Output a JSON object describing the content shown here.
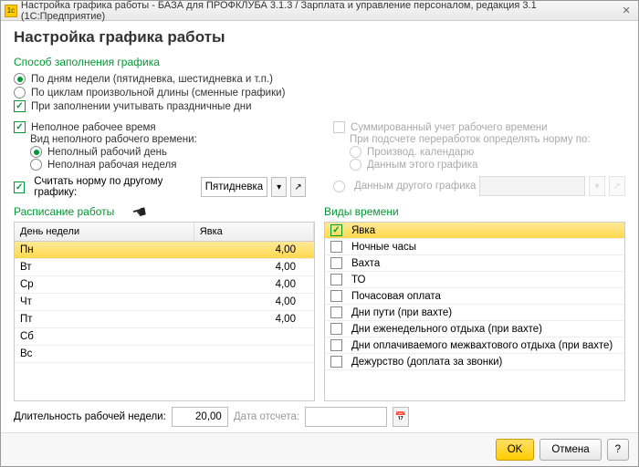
{
  "titlebar": {
    "text": "Настройка графика работы - БАЗА для ПРОФКЛУБА 3.1.3 / Зарплата и управление персоналом, редакция 3.1  (1С:Предприятие)"
  },
  "page_title": "Настройка графика работы",
  "fill_method": {
    "title": "Способ заполнения графика",
    "opt1": "По дням недели (пятидневка, шестидневка и т.п.)",
    "opt2": "По циклам произвольной длины (сменные графики)",
    "holidays": "При заполнении учитывать праздничные дни"
  },
  "left": {
    "part_time_check": "Неполное рабочее время",
    "part_time_kind_label": "Вид неполного рабочего времени:",
    "opt_day": "Неполный рабочий день",
    "opt_week": "Неполная рабочая неделя",
    "norm_by_other_label": "Считать норму по другому графику:",
    "norm_combo": "Пятидневка"
  },
  "right": {
    "sum_check": "Суммированный учет рабочего времени",
    "norm_label": "При подсчете переработок определять норму по:",
    "opt_cal": "Производ. календарю",
    "opt_this": "Данным этого графика",
    "opt_other": "Данным другого графика"
  },
  "schedule": {
    "title": "Расписание работы",
    "col_day": "День недели",
    "col_appear": "Явка",
    "rows": [
      {
        "day": "Пн",
        "val": "4,00"
      },
      {
        "day": "Вт",
        "val": "4,00"
      },
      {
        "day": "Ср",
        "val": "4,00"
      },
      {
        "day": "Чт",
        "val": "4,00"
      },
      {
        "day": "Пт",
        "val": "4,00"
      },
      {
        "day": "Сб",
        "val": ""
      },
      {
        "day": "Вс",
        "val": ""
      }
    ]
  },
  "time_types": {
    "title": "Виды времени",
    "rows": [
      {
        "label": "Явка",
        "checked": true
      },
      {
        "label": "Ночные часы",
        "checked": false
      },
      {
        "label": "Вахта",
        "checked": false
      },
      {
        "label": "ТО",
        "checked": false
      },
      {
        "label": "Почасовая оплата",
        "checked": false
      },
      {
        "label": "Дни пути (при вахте)",
        "checked": false
      },
      {
        "label": "Дни еженедельного отдыха (при вахте)",
        "checked": false
      },
      {
        "label": "Дни оплачиваемого межвахтового отдыха (при вахте)",
        "checked": false
      },
      {
        "label": "Дежурство (доплата за звонки)",
        "checked": false
      }
    ]
  },
  "bottom": {
    "week_len_label": "Длительность рабочей недели:",
    "week_len_value": "20,00",
    "date_label": "Дата отсчета:"
  },
  "footer": {
    "ok": "OK",
    "cancel": "Отмена",
    "help": "?"
  }
}
